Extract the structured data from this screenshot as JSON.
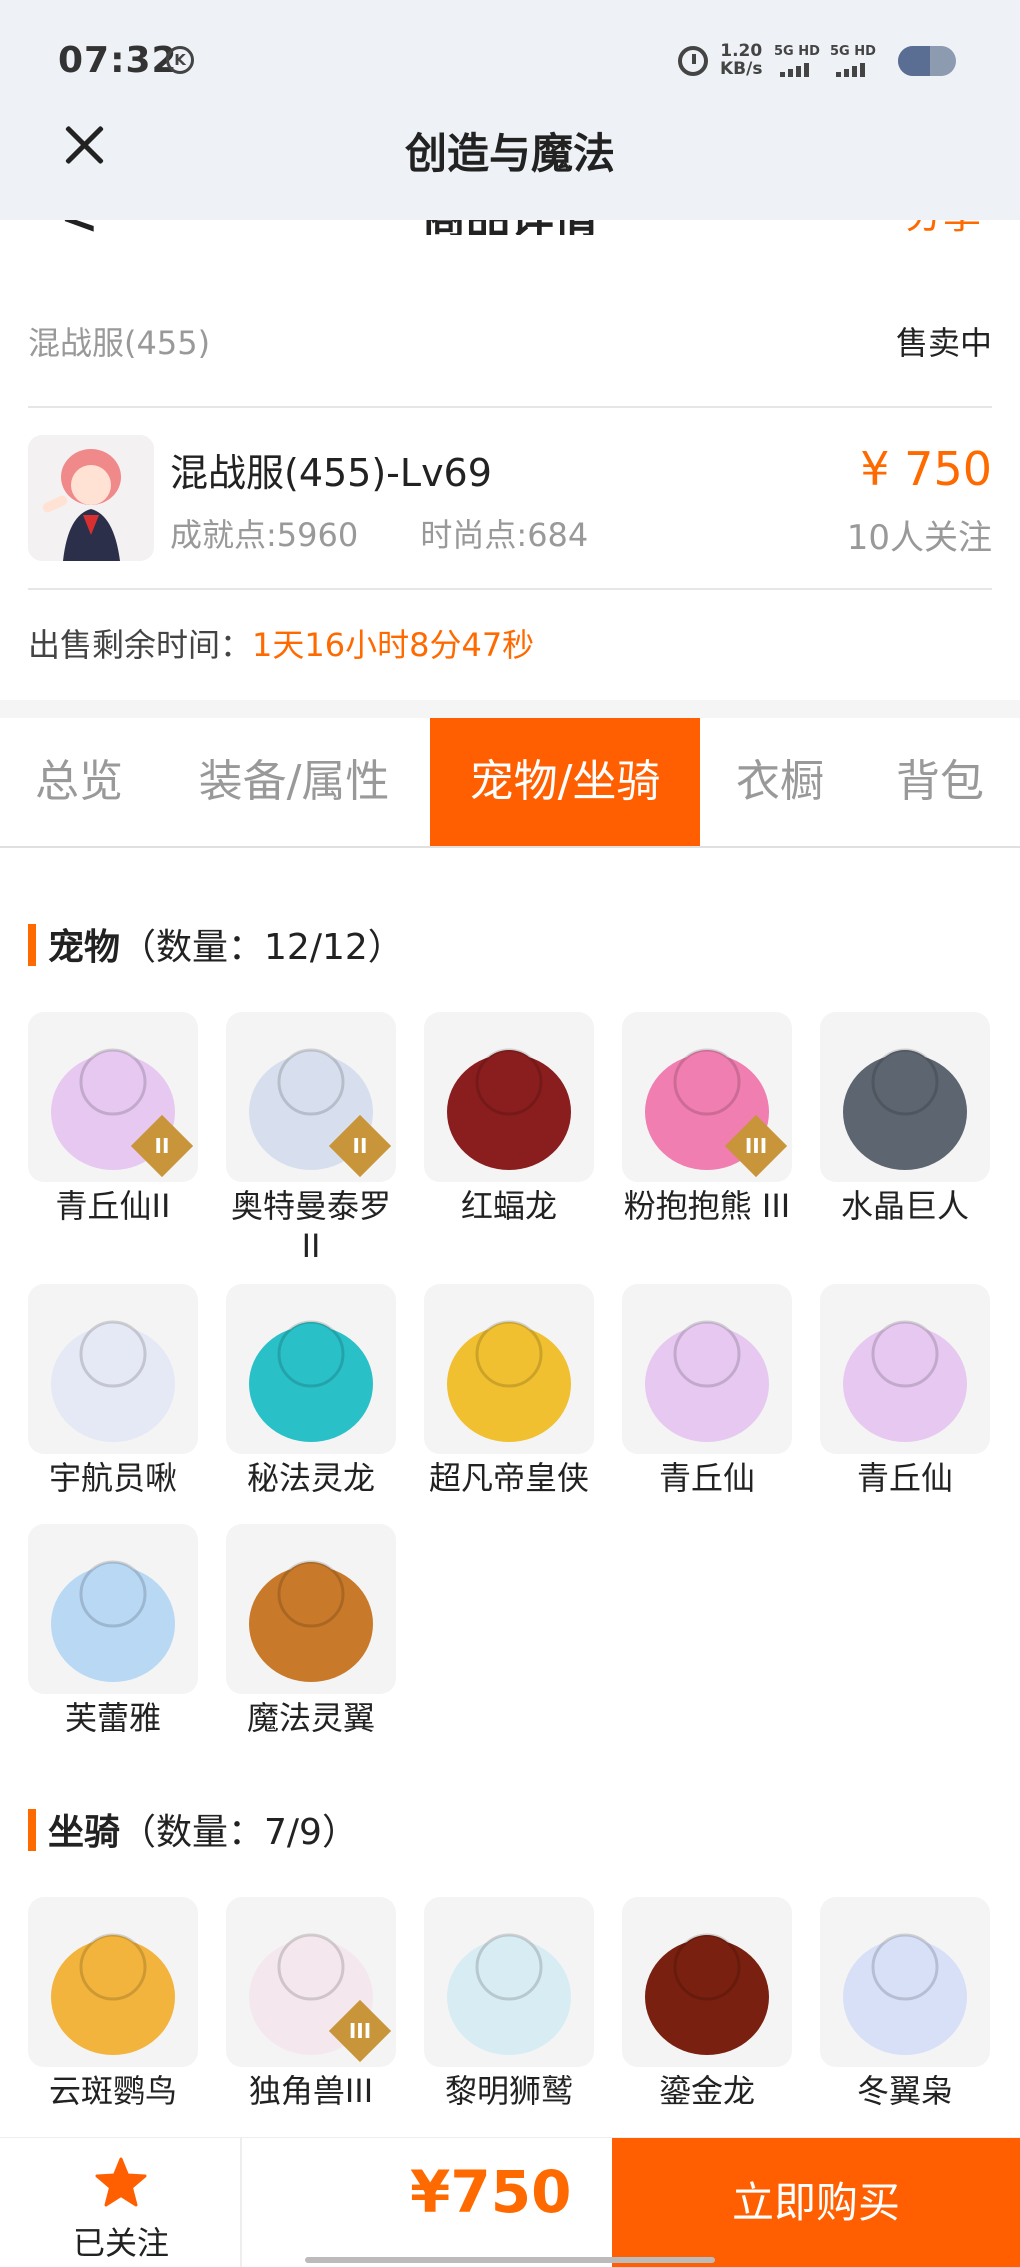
{
  "status_bar": {
    "time": "07:32",
    "k_badge": "K",
    "net_speed": "1.20",
    "net_unit": "KB/s",
    "sim1": "5G HD",
    "sim2": "5G HD"
  },
  "app_title": "创造与魔法",
  "inner_header": {
    "title": "商品详情",
    "share": "分享"
  },
  "server": {
    "name": "混战服(455)",
    "status": "售卖中"
  },
  "item": {
    "title": "混战服(455)-Lv69",
    "achievement": "成就点:5960",
    "fashion": "时尚点:684",
    "price": "¥ 750",
    "followers": "10人关注"
  },
  "timer": {
    "label": "出售剩余时间：",
    "value": "1天16小时8分47秒"
  },
  "tabs": [
    {
      "label": "总览"
    },
    {
      "label": "装备/属性"
    },
    {
      "label": "宠物/坐骑"
    },
    {
      "label": "衣橱"
    },
    {
      "label": "背包"
    }
  ],
  "active_tab": "宠物/坐骑",
  "pets_section": {
    "title": "宠物",
    "count": "（数量：12/12）"
  },
  "pets": [
    {
      "name": "青丘仙II",
      "color": "#e6c8f0",
      "badge": "II"
    },
    {
      "name": "奥特曼泰罗II",
      "color": "#d7dfee",
      "badge": "II"
    },
    {
      "name": "红蝠龙",
      "color": "#8a1e1e",
      "badge": ""
    },
    {
      "name": "粉抱抱熊 III",
      "color": "#f07eb0",
      "badge": "III"
    },
    {
      "name": "水晶巨人",
      "color": "#5d6570",
      "badge": ""
    },
    {
      "name": "宇航员啾",
      "color": "#e5e8f5",
      "badge": ""
    },
    {
      "name": "秘法灵龙",
      "color": "#2ac0c8",
      "badge": ""
    },
    {
      "name": "超凡帝皇侠",
      "color": "#f0c030",
      "badge": ""
    },
    {
      "name": "青丘仙",
      "color": "#e6c8f0",
      "badge": ""
    },
    {
      "name": "青丘仙",
      "color": "#e6c8f0",
      "badge": ""
    },
    {
      "name": "芙蕾雅",
      "color": "#b8d8f4",
      "badge": ""
    },
    {
      "name": "魔法灵翼",
      "color": "#c87a2a",
      "badge": ""
    }
  ],
  "mounts_section": {
    "title": "坐骑",
    "count": "（数量：7/9）"
  },
  "mounts": [
    {
      "name": "云斑鹦鸟",
      "color": "#f2b43c",
      "badge": ""
    },
    {
      "name": "独角兽III",
      "color": "#f4e8ee",
      "badge": "III"
    },
    {
      "name": "黎明狮鹫",
      "color": "#d8ecf4",
      "badge": ""
    },
    {
      "name": "鎏金龙",
      "color": "#7a2010",
      "badge": ""
    },
    {
      "name": "冬翼枭",
      "color": "#d8e0f8",
      "badge": ""
    }
  ],
  "bottom_bar": {
    "follow_label": "已关注",
    "price": "¥750",
    "buy_label": "立即购买"
  },
  "colors": {
    "accent": "#ff5f00",
    "price": "#ff6a00"
  }
}
